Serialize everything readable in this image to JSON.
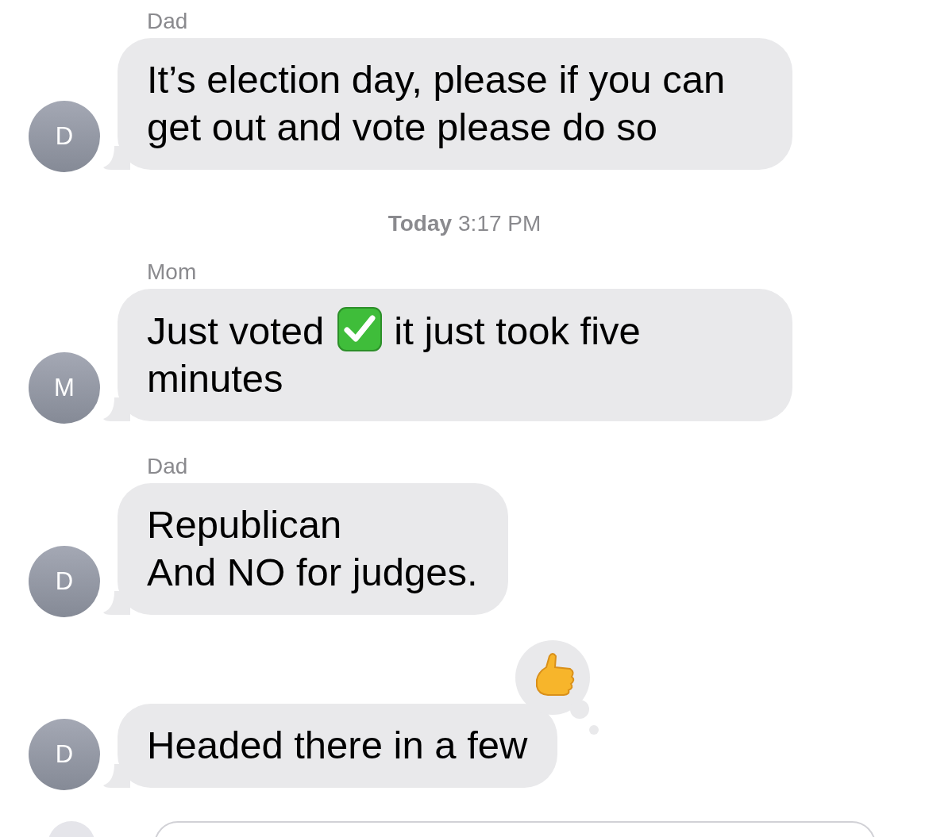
{
  "thread": [
    {
      "kind": "message",
      "sender": "Dad",
      "avatar": "D",
      "segments": [
        {
          "kind": "text",
          "text": "It’s election day, please if you can get out and vote please do so"
        }
      ]
    },
    {
      "kind": "timestamp",
      "day": "Today",
      "time": "3:17 PM"
    },
    {
      "kind": "message",
      "sender": "Mom",
      "avatar": "M",
      "segments": [
        {
          "kind": "text",
          "text": "Just voted"
        },
        {
          "kind": "check"
        },
        {
          "kind": "text",
          "text": "it just took five"
        },
        {
          "kind": "text",
          "text": "minutes"
        }
      ]
    },
    {
      "kind": "message",
      "sender": "Dad",
      "avatar": "D",
      "segments": [
        {
          "kind": "text",
          "text": "Republican\nAnd NO for judges."
        }
      ]
    },
    {
      "kind": "message",
      "avatar": "D",
      "reacted": true,
      "segments": [
        {
          "kind": "text",
          "text": "Headed there in a few"
        }
      ]
    }
  ]
}
